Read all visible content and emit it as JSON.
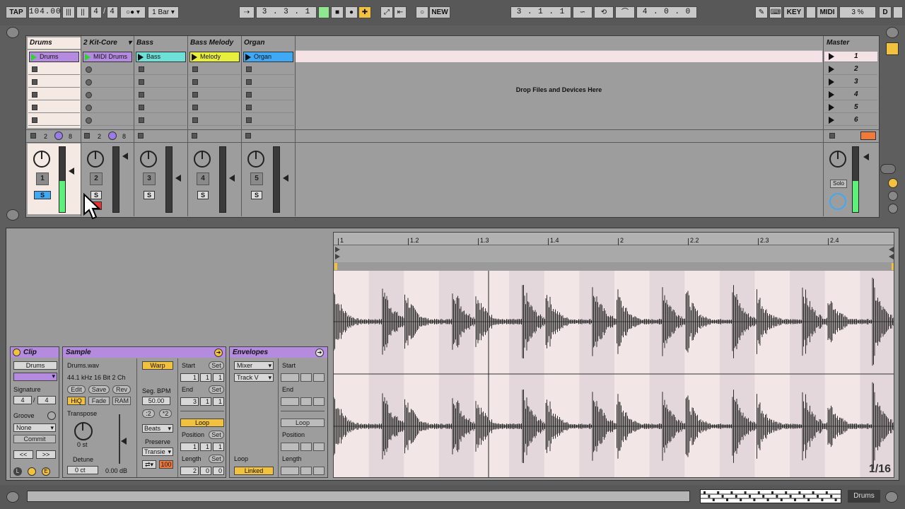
{
  "transport": {
    "tap": "TAP",
    "tempo": "104.00",
    "signature_num": "4",
    "signature_den": "4",
    "quantize": "1 Bar",
    "position": "3 .  3 .  1",
    "new_label": "NEW",
    "loop_start": "3 .  1 .  1",
    "loop_length": "4 .  0 .  0",
    "key_label": "KEY",
    "midi_label": "MIDI",
    "cpu": "3 %",
    "d_label": "D"
  },
  "tracks": [
    {
      "name": "Drums",
      "clip": "Drums",
      "color": "#b58be0",
      "number": "1"
    },
    {
      "name": "2 Kit-Core",
      "clip": "MIDI Drums",
      "color": "#b58be0",
      "number": "2"
    },
    {
      "name": "Bass",
      "clip": "Bass",
      "color": "#6fe0d8",
      "number": "3"
    },
    {
      "name": "Bass Melody",
      "clip": "Melody",
      "color": "#e8ee3c",
      "number": "4"
    },
    {
      "name": "Organ",
      "clip": "Organ",
      "color": "#3fa9f5",
      "number": "5"
    }
  ],
  "group_values": {
    "a": "2",
    "b": "8"
  },
  "solo_label": "S",
  "drop_text": "Drop Files and Devices Here",
  "master": {
    "name": "Master",
    "scenes": [
      "1",
      "2",
      "3",
      "4",
      "5",
      "6"
    ],
    "solo": "Solo"
  },
  "clip_panel": {
    "title": "Clip",
    "clip_name": "Drums",
    "signature_label": "Signature",
    "sig_num": "4",
    "sig_den": "4",
    "groove_label": "Groove",
    "groove_value": "None",
    "commit": "Commit",
    "prev": "<<",
    "next": ">>"
  },
  "sample_panel": {
    "title": "Sample",
    "file": "Drums.wav",
    "info": "44.1 kHz 16 Bit 2 Ch",
    "edit": "Edit",
    "save": "Save",
    "rev": "Rev",
    "hiq": "HiQ",
    "fade": "Fade",
    "ram": "RAM",
    "transpose_label": "Transpose",
    "transpose_value": "0 st",
    "detune_label": "Detune",
    "detune_value": "0 ct",
    "gain_value": "0.00 dB",
    "warp": "Warp",
    "seg_bpm_label": "Seg. BPM",
    "seg_bpm_value": "50.00",
    "half": ":2",
    "double": "*2",
    "warp_mode": "Beats",
    "preserve_label": "Preserve",
    "preserve_value": "Transie",
    "hundred": "100",
    "start_label": "Start",
    "set": "Set",
    "start_vals": [
      "1",
      "1",
      "1"
    ],
    "end_label": "End",
    "end_vals": [
      "3",
      "1",
      "1"
    ],
    "loop": "Loop",
    "position_label": "Position",
    "position_vals": [
      "1",
      "1",
      "1"
    ],
    "length_label": "Length",
    "length_vals": [
      "2",
      "0",
      "0"
    ]
  },
  "env_panel": {
    "title": "Envelopes",
    "device": "Mixer",
    "control": "Track V",
    "start_label": "Start",
    "end_label": "End",
    "loop": "Loop",
    "position_label": "Position",
    "loop_label": "Loop",
    "length_label": "Length",
    "linked": "Linked"
  },
  "ruler_labels": [
    "1",
    "1.2",
    "1.3",
    "1.4",
    "2",
    "2.2",
    "2.3",
    "2.4"
  ],
  "grid_label": "1/16",
  "bottom": {
    "track_label": "Drums"
  }
}
